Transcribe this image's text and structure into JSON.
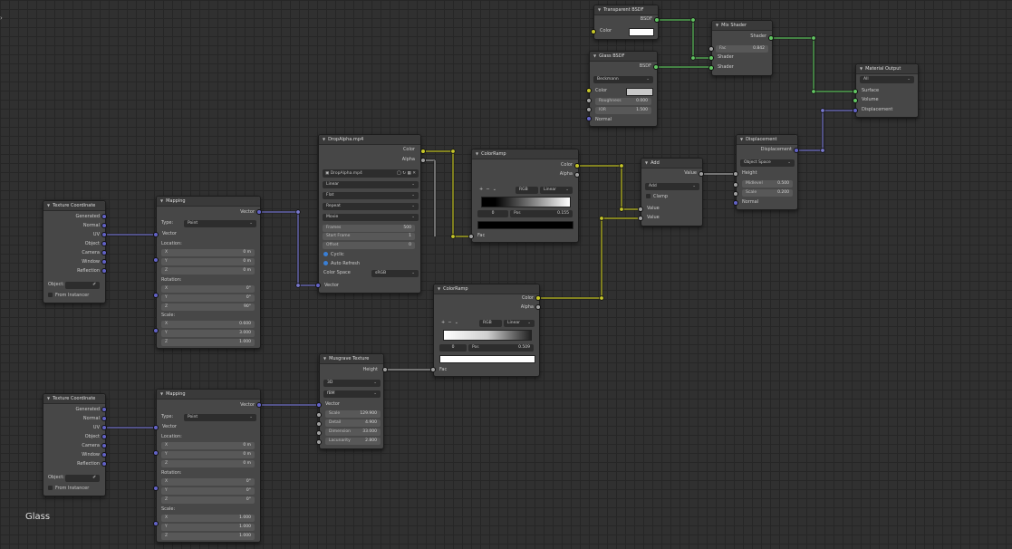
{
  "frame_label": "Glass",
  "colors": {
    "yellow_socket": "#c7c729",
    "purple_socket": "#6363c7",
    "green_socket": "#63c763",
    "gray_socket": "#a1a1a1",
    "background": "#303030"
  },
  "texcoord1": {
    "title": "Texture Coordinate",
    "outputs": [
      "Generated",
      "Normal",
      "UV",
      "Object",
      "Camera",
      "Window",
      "Reflection"
    ],
    "object_label": "Object:",
    "from_instancer": "From Instancer"
  },
  "texcoord2": {
    "title": "Texture Coordinate",
    "outputs": [
      "Generated",
      "Normal",
      "UV",
      "Object",
      "Camera",
      "Window",
      "Reflection"
    ],
    "object_label": "Object:",
    "from_instancer": "From Instancer"
  },
  "mapping1": {
    "title": "Mapping",
    "output": "Vector",
    "type_label": "Type:",
    "type_value": "Point",
    "vector_input": "Vector",
    "location_label": "Location:",
    "location": [
      [
        "X",
        "0 m"
      ],
      [
        "Y",
        "0 m"
      ],
      [
        "Z",
        "0 m"
      ]
    ],
    "rotation_label": "Rotation:",
    "rotation": [
      [
        "X",
        "0°"
      ],
      [
        "Y",
        "0°"
      ],
      [
        "Z",
        "90°"
      ]
    ],
    "scale_label": "Scale:",
    "scale": [
      [
        "X",
        "0.600"
      ],
      [
        "Y",
        "3.000"
      ],
      [
        "Z",
        "1.000"
      ]
    ]
  },
  "mapping2": {
    "title": "Mapping",
    "output": "Vector",
    "type_label": "Type:",
    "type_value": "Point",
    "vector_input": "Vector",
    "location_label": "Location:",
    "location": [
      [
        "X",
        "0 m"
      ],
      [
        "Y",
        "0 m"
      ],
      [
        "Z",
        "0 m"
      ]
    ],
    "rotation_label": "Rotation:",
    "rotation": [
      [
        "X",
        "0°"
      ],
      [
        "Y",
        "0°"
      ],
      [
        "Z",
        "0°"
      ]
    ],
    "scale_label": "Scale:",
    "scale": [
      [
        "X",
        "1.000"
      ],
      [
        "Y",
        "1.000"
      ],
      [
        "Z",
        "1.000"
      ]
    ]
  },
  "image_tex": {
    "title": "DropAlpha.mp4",
    "outputs": [
      "Color",
      "Alpha"
    ],
    "image_name": "DropAlpha.mp4",
    "interpolation": "Linear",
    "projection": "Flat",
    "extension": "Repeat",
    "source": "Movie",
    "frames_label": "Frames",
    "frames_value": "500",
    "start_label": "Start Frame",
    "start_value": "1",
    "offset_label": "Offset",
    "offset_value": "0",
    "cyclic": "Cyclic",
    "auto_refresh": "Auto Refresh",
    "colorspace_label": "Color Space",
    "colorspace_value": "sRGB",
    "vector_input": "Vector"
  },
  "ramp1": {
    "title": "ColorRamp",
    "outputs": [
      "Color",
      "Alpha"
    ],
    "mode": "RGB",
    "interp": "Linear",
    "stop_index": "0",
    "pos_label": "Pos",
    "pos_value": "0.155",
    "fac_input": "Fac"
  },
  "ramp2": {
    "title": "ColorRamp",
    "outputs": [
      "Color",
      "Alpha"
    ],
    "mode": "RGB",
    "interp": "Linear",
    "stop_index": "0",
    "pos_label": "Pos",
    "pos_value": "0.509",
    "fac_input": "Fac"
  },
  "musgrave": {
    "title": "Musgrave Texture",
    "output": "Height",
    "dimensions": "3D",
    "type": "fBM",
    "vector_input": "Vector",
    "fields": [
      [
        "Scale",
        "129.900"
      ],
      [
        "Detail",
        "4.900"
      ],
      [
        "Dimension",
        "33.000"
      ],
      [
        "Lacunarity",
        "2.800"
      ]
    ]
  },
  "add": {
    "title": "Add",
    "output": "Value",
    "operation": "Add",
    "clamp": "Clamp",
    "inputs": [
      "Value",
      "Value"
    ]
  },
  "displacement": {
    "title": "Displacement",
    "output": "Displacement",
    "space": "Object Space",
    "height_input": "Height",
    "midlevel_label": "Midlevel",
    "midlevel_value": "0.500",
    "scale_label": "Scale",
    "scale_value": "0.200",
    "normal_input": "Normal"
  },
  "transparent": {
    "title": "Transparent BSDF",
    "output": "BSDF",
    "color_label": "Color"
  },
  "glass": {
    "title": "Glass BSDF",
    "output": "BSDF",
    "distribution": "Beckmann",
    "color_label": "Color",
    "roughness_label": "Roughness",
    "roughness_value": "0.000",
    "ior_label": "IOR",
    "ior_value": "1.500",
    "normal_input": "Normal"
  },
  "mix": {
    "title": "Mix Shader",
    "output": "Shader",
    "fac_label": "Fac",
    "fac_value": "0.842",
    "inputs": [
      "Shader",
      "Shader"
    ]
  },
  "output": {
    "title": "Material Output",
    "target": "All",
    "inputs": [
      "Surface",
      "Volume",
      "Displacement"
    ]
  }
}
